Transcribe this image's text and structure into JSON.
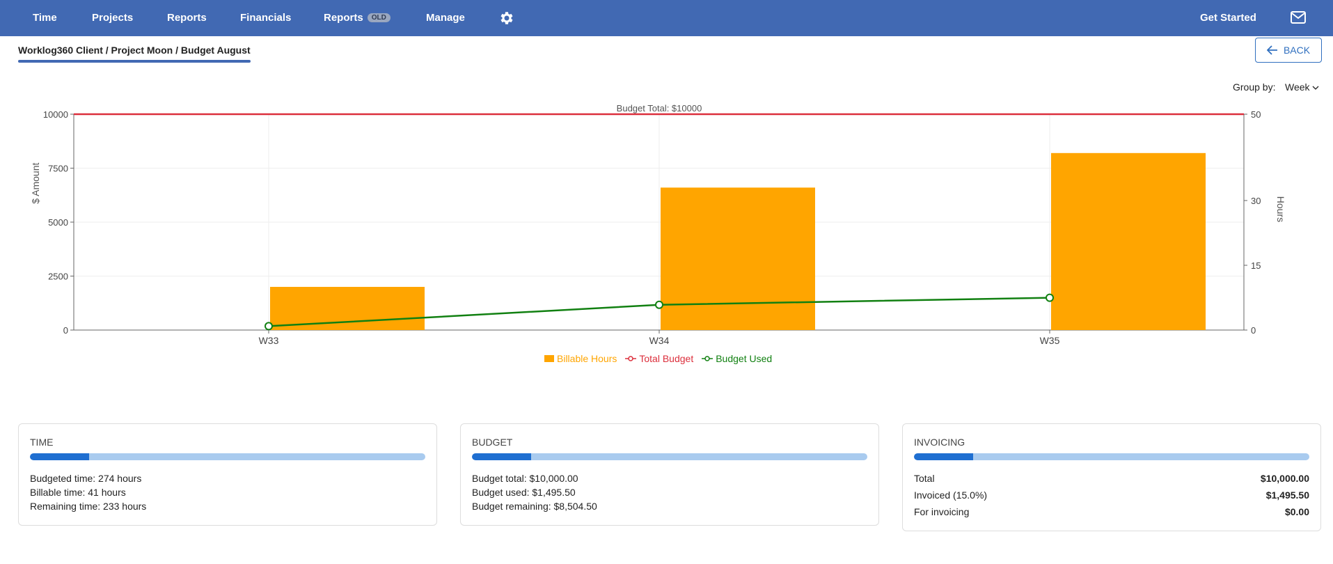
{
  "nav": {
    "items": [
      "Time",
      "Projects",
      "Reports",
      "Financials",
      "Reports",
      "Manage"
    ],
    "old_badge": "OLD",
    "get_started": "Get Started",
    "icons": [
      "gear-icon",
      "mail-icon"
    ]
  },
  "breadcrumb": "Worklog360 Client / Project Moon / Budget August",
  "back_label": "BACK",
  "group_by": {
    "label": "Group by:",
    "value": "Week"
  },
  "colors": {
    "nav": "#4169b3",
    "bar": "#ffa500",
    "total": "#dc2f3c",
    "used": "#118011"
  },
  "chart_data": {
    "type": "bar",
    "categories": [
      "W33",
      "W34",
      "W35"
    ],
    "series": [
      {
        "name": "Billable Hours",
        "type": "bar",
        "axis": "right",
        "values": [
          10,
          33,
          41
        ]
      },
      {
        "name": "Total Budget",
        "type": "line",
        "axis": "left",
        "values": [
          10000,
          10000,
          10000
        ]
      },
      {
        "name": "Budget Used",
        "type": "line",
        "axis": "left",
        "values": [
          180,
          1170,
          1495.5
        ]
      }
    ],
    "annotation": "Budget Total: $10000",
    "ylabel_left": "$ Amount",
    "ylabel_right": "Hours",
    "ylim_left": [
      0,
      10000
    ],
    "ylim_right": [
      0,
      50
    ],
    "yticks_left": [
      "0",
      "2500",
      "5000",
      "7500",
      "10000"
    ],
    "yticks_right": [
      "0",
      "15",
      "30",
      "50"
    ],
    "legend_position": "bottom"
  },
  "cards": {
    "time": {
      "title": "TIME",
      "progress": 0.15,
      "lines": [
        "Budgeted time: 274 hours",
        "Billable time: 41 hours",
        "Remaining time: 233 hours"
      ]
    },
    "budget": {
      "title": "BUDGET",
      "progress": 0.15,
      "lines": [
        "Budget total: $10,000.00",
        "Budget used: $1,495.50",
        "Budget remaining: $8,504.50"
      ]
    },
    "invoicing": {
      "title": "INVOICING",
      "progress": 0.15,
      "rows": [
        {
          "label": "Total",
          "value": "$10,000.00"
        },
        {
          "label": "Invoiced (15.0%)",
          "value": "$1,495.50"
        },
        {
          "label": "For invoicing",
          "value": "$0.00"
        }
      ]
    }
  }
}
